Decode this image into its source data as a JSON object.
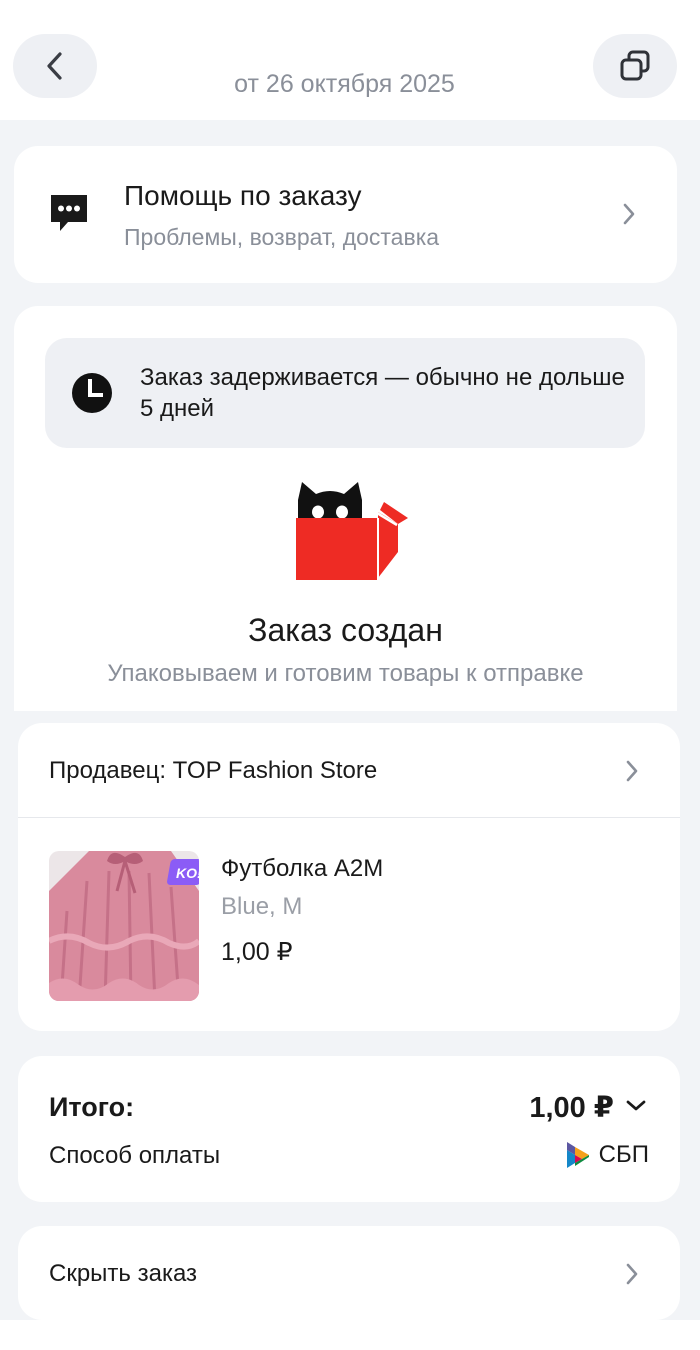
{
  "header": {
    "back_icon": "chevron-left-icon",
    "copy_icon": "copy-icon",
    "date": "от 26 октября 2025"
  },
  "help": {
    "icon": "chat-bubble-icon",
    "title": "Помощь по заказу",
    "subtitle": "Проблемы, возврат, доставка"
  },
  "status": {
    "delay_icon": "clock-icon",
    "delay_message": "Заказ задерживается — обычно не дольше 5 дней",
    "illustration": "cat-in-box-icon",
    "title": "Заказ создан",
    "subtitle": "Упаковываем и готовим товары к отправке"
  },
  "seller": {
    "label": "Продавец: TOP Fashion Store"
  },
  "product": {
    "name": "Футболка A2M",
    "variant": "Blue, M",
    "price": "1,00 ₽",
    "badge": "KO!"
  },
  "total": {
    "label": "Итого:",
    "value": "1,00 ₽",
    "payment_label": "Способ оплаты",
    "payment_method": "СБП"
  },
  "actions": {
    "hide_order": "Скрыть заказ"
  },
  "colors": {
    "accent_red": "#ee2b24",
    "badge_purple": "#8b5cf6",
    "background": "#f2f4f7"
  }
}
